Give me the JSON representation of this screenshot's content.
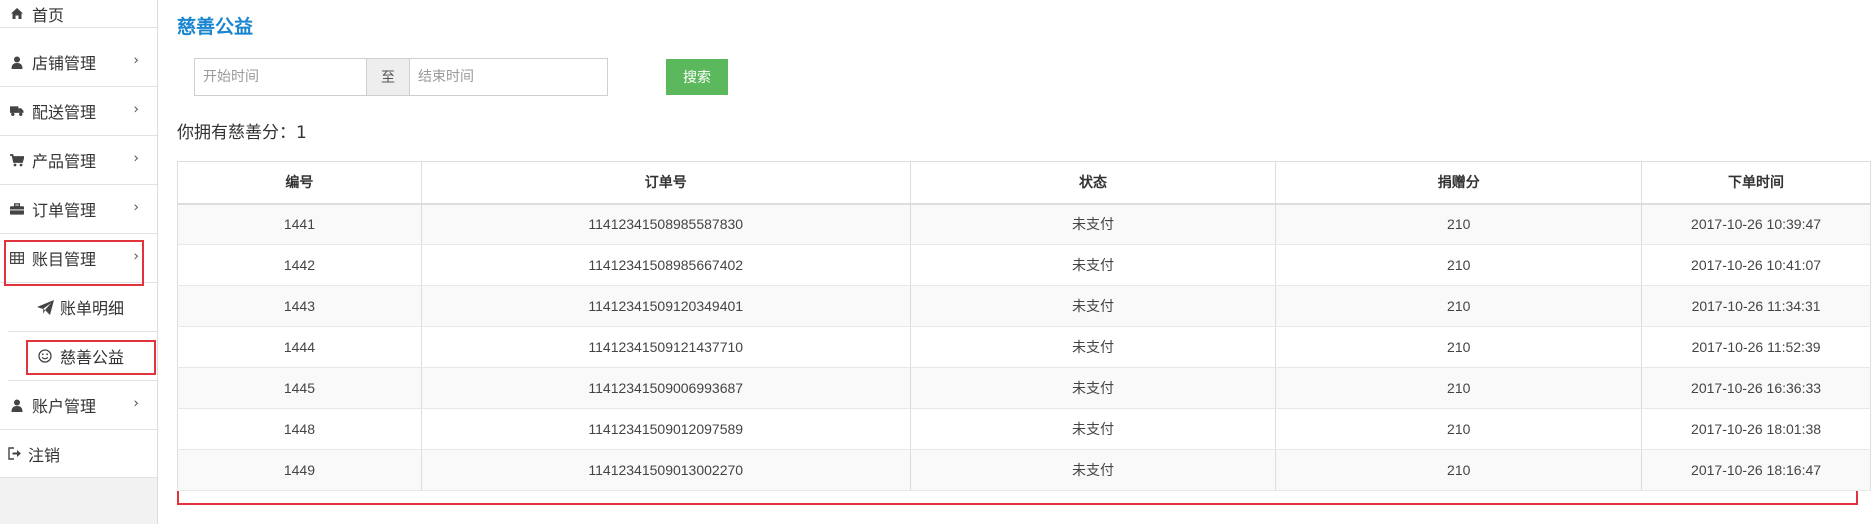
{
  "sidebar": {
    "home": "首页",
    "items": [
      {
        "label": "店铺管理",
        "icon": "user-icon"
      },
      {
        "label": "配送管理",
        "icon": "truck-icon"
      },
      {
        "label": "产品管理",
        "icon": "cart-icon"
      },
      {
        "label": "订单管理",
        "icon": "briefcase-icon"
      },
      {
        "label": "账目管理",
        "icon": "table-icon"
      }
    ],
    "sub_items": [
      {
        "label": "账单明细",
        "icon": "paper-plane-icon"
      },
      {
        "label": "慈善公益",
        "icon": "smile-icon"
      }
    ],
    "account": "账户管理",
    "logout": "注销",
    "chevron": "›"
  },
  "page": {
    "title": "慈善公益",
    "score_text": "你拥有慈善分：1"
  },
  "filter": {
    "start_placeholder": "开始时间",
    "separator": "至",
    "end_placeholder": "结束时间",
    "search_label": "搜索"
  },
  "table": {
    "headers": [
      "编号",
      "订单号",
      "状态",
      "捐赠分",
      "下单时间"
    ],
    "rows": [
      [
        "1441",
        "11412341508985587830",
        "未支付",
        "210",
        "2017-10-26 10:39:47"
      ],
      [
        "1442",
        "11412341508985667402",
        "未支付",
        "210",
        "2017-10-26 10:41:07"
      ],
      [
        "1443",
        "11412341509120349401",
        "未支付",
        "210",
        "2017-10-26 11:34:31"
      ],
      [
        "1444",
        "11412341509121437710",
        "未支付",
        "210",
        "2017-10-26 11:52:39"
      ],
      [
        "1445",
        "11412341509006993687",
        "未支付",
        "210",
        "2017-10-26 16:36:33"
      ],
      [
        "1448",
        "11412341509012097589",
        "未支付",
        "210",
        "2017-10-26 18:01:38"
      ],
      [
        "1449",
        "11412341509013002270",
        "未支付",
        "210",
        "2017-10-26 18:16:47"
      ]
    ]
  },
  "colors": {
    "title": "#1a86cf",
    "search_button": "#5cb85c",
    "highlight_box": "#e0333b"
  }
}
